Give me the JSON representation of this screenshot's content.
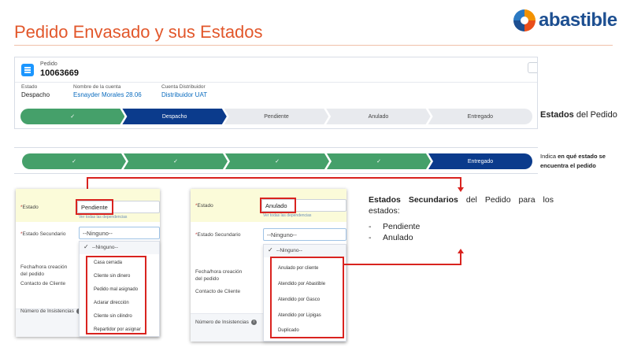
{
  "slide": {
    "title": "Pedido Envasado y sus Estados",
    "brand": "abastible"
  },
  "order": {
    "object_type": "Pedido",
    "number": "10063669",
    "fields": [
      {
        "label": "Estado",
        "value": "Despacho",
        "link": false
      },
      {
        "label": "Nombre de la cuenta",
        "value": "Esnayder Morales 28.06",
        "link": true
      },
      {
        "label": "Cuenta Distribuidor",
        "value": "Distribuidor UAT",
        "link": true
      }
    ]
  },
  "path_1": {
    "steps": [
      {
        "label": "✓",
        "state": "done"
      },
      {
        "label": "Despacho",
        "state": "current"
      },
      {
        "label": "Pendiente",
        "state": "todo"
      },
      {
        "label": "Anulado",
        "state": "todo"
      },
      {
        "label": "Entregado",
        "state": "todo"
      }
    ]
  },
  "path_2": {
    "steps": [
      {
        "label": "✓",
        "state": "done"
      },
      {
        "label": "✓",
        "state": "done"
      },
      {
        "label": "✓",
        "state": "done"
      },
      {
        "label": "✓",
        "state": "done"
      },
      {
        "label": "Entregado",
        "state": "current"
      }
    ]
  },
  "notes": {
    "estados_bold": "Estados",
    "estados_rest": " del Pedido",
    "indica_pre": "Indica ",
    "indica_bold": "en qué estado se encuentra el pedido"
  },
  "form_1": {
    "estado_label": "Estado",
    "estado_value": "Pendiente",
    "dependencies_link": "Ver todas las dependencias",
    "secundario_label": "Estado Secundario",
    "secundario_value": "--Ninguno--",
    "fecha_label_1": "Fecha/hora creación",
    "fecha_label_2": "del pedido",
    "contacto_label": "Contacto de Cliente",
    "insistencias_label": "Número de Insistencias",
    "dropdown_first": "--Ninguno--",
    "options": [
      "Casa cerrada",
      "Cliente sin dinero",
      "Pedido mal asignado",
      "Aclarar dirección",
      "Cliente sin cilindro",
      "Repartidor por asignar"
    ]
  },
  "form_2": {
    "estado_label": "Estado",
    "estado_value": "Anulado",
    "dependencies_link": "Ver todas las dependencias",
    "secundario_label": "Estado Secundario",
    "secundario_value": "--Ninguno--",
    "fecha_label_1": "Fecha/hora creación",
    "fecha_label_2": "del pedido",
    "contacto_label": "Contacto de Cliente",
    "insistencias_label": "Número de Insistencias",
    "dropdown_first": "--Ninguno--",
    "options": [
      "Anulado por cliente",
      "Atendido por Abastible",
      "Atendido por Gasco",
      "Atendido por Lipigas",
      "Duplicado"
    ]
  },
  "explanation": {
    "bold": "Estados Secundarios",
    "rest": " del Pedido para los estados:",
    "items": [
      "Pendiente",
      "Anulado"
    ]
  },
  "colors": {
    "title": "#e2572b",
    "step_done": "#45a06a",
    "step_current": "#0b3b8c",
    "highlight": "#d9231f",
    "brand": "#1d4f91"
  }
}
